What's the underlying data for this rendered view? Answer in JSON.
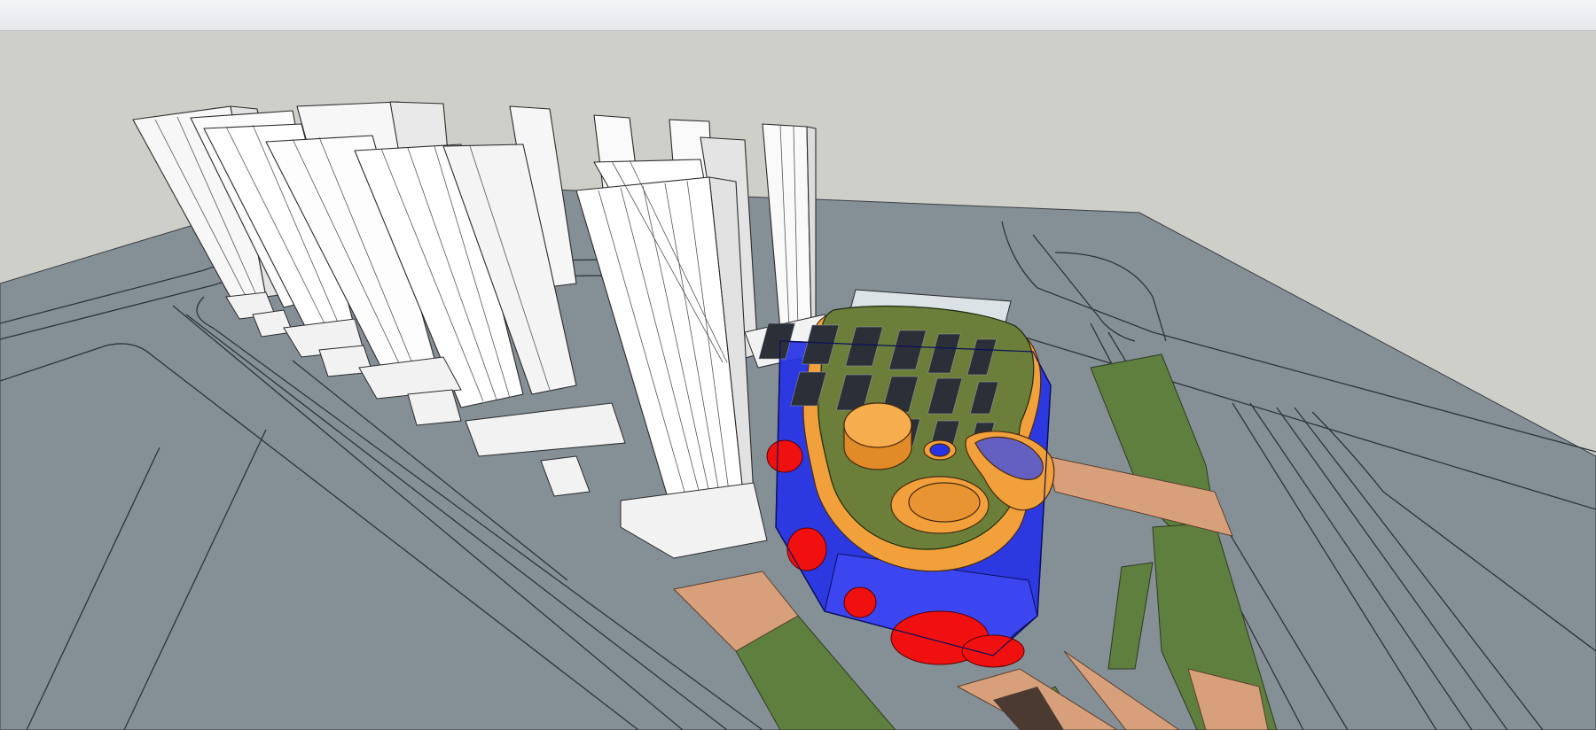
{
  "window": {
    "title": ""
  },
  "viewport": {
    "scene": "3d-model-view",
    "tool": "orbit"
  },
  "colors": {
    "sky": "#cfcfca",
    "ground": "#848f96",
    "road_line": "#2b2f33",
    "tower": "#ffffff",
    "podium_blue": "#1f2de0",
    "podium_red": "#f01010",
    "roof_green": "#6b7f3a",
    "accent_orange": "#f2a03c",
    "lawn": "#5f7f3e",
    "paving": "#d8a07a",
    "glass": "#dbe3e6"
  }
}
